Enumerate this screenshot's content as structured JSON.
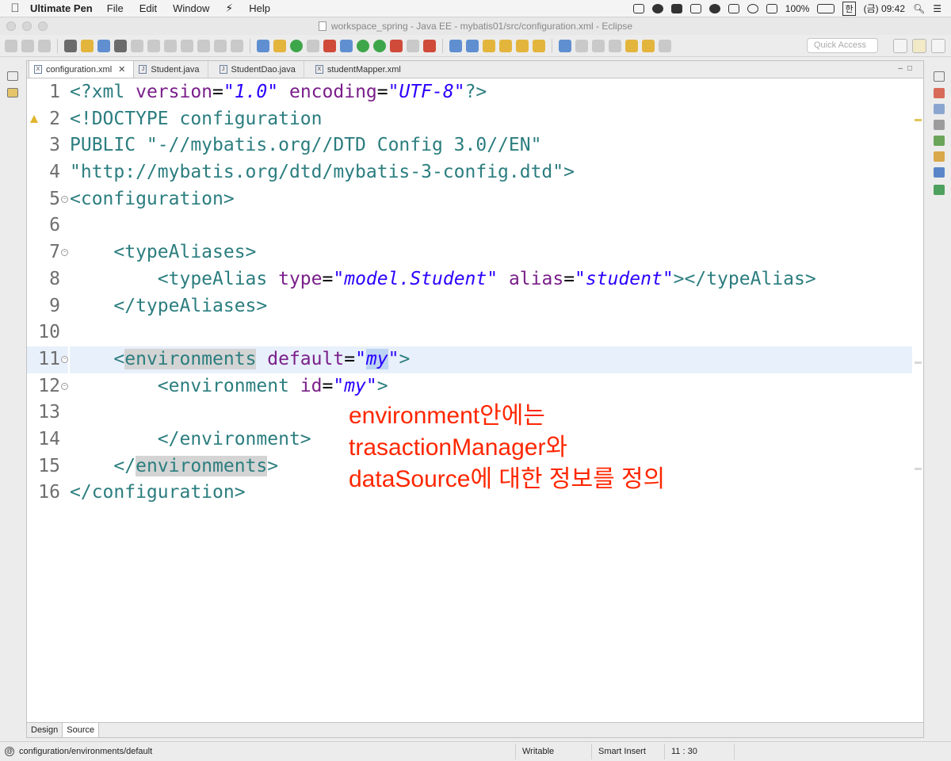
{
  "menubar": {
    "app_name": "Ultimate Pen",
    "items": [
      "File",
      "Edit",
      "Window",
      "Help"
    ],
    "battery": "100%",
    "input_method": "한",
    "clock": "(금) 09:42"
  },
  "window": {
    "title": "workspace_spring - Java EE - mybatis01/src/configuration.xml - Eclipse"
  },
  "toolbar": {
    "quick_access_placeholder": "Quick Access"
  },
  "editor": {
    "tabs": [
      {
        "label": "configuration.xml",
        "icon": "X",
        "active": true
      },
      {
        "label": "Student.java",
        "icon": "J",
        "active": false
      },
      {
        "label": "StudentDao.java",
        "icon": "J",
        "active": false
      },
      {
        "label": "studentMapper.xml",
        "icon": "X",
        "active": false
      }
    ],
    "line_numbers": [
      "1",
      "2",
      "3",
      "4",
      "5",
      "6",
      "7",
      "8",
      "9",
      "10",
      "11",
      "12",
      "13",
      "14",
      "15",
      "16"
    ],
    "code": {
      "l1_open": "<?xml ",
      "l1_attr1": "version",
      "l1_eq1": "=",
      "l1_val1": "\"1.0\"",
      "l1_attr2": " encoding",
      "l1_eq2": "=",
      "l1_val2": "\"UTF-8\"",
      "l1_close": "?>",
      "l2": "<!DOCTYPE configuration",
      "l3": "PUBLIC \"-//mybatis.org//DTD Config 3.0//EN\"",
      "l4": "\"http://mybatis.org/dtd/mybatis-3-config.dtd\">",
      "l5": "<configuration>",
      "l7": "<typeAliases>",
      "l8_open": "<typeAlias",
      "l8_attr1": " type",
      "l8_eq1": "=",
      "l8_val1": "\"model.Student\"",
      "l8_attr2": " alias",
      "l8_eq2": "=",
      "l8_val2": "\"student\"",
      "l8_close": "></typeAlias>",
      "l9": "</typeAliases>",
      "l11_lt": "<",
      "l11_tag": "environments",
      "l11_attr": " default",
      "l11_eq": "=",
      "l11_q1": "\"",
      "l11_val": "my",
      "l11_q2": "\"",
      "l11_close": ">",
      "l12_open": "<environment",
      "l12_attr": " id",
      "l12_eq": "=",
      "l12_val": "\"my\"",
      "l12_close": ">",
      "l14": "</environment>",
      "l15_lt": "</",
      "l15_tag": "environments",
      "l15_close": ">",
      "l16": "</configuration>"
    },
    "annotation": {
      "line1": "environment안에는",
      "line2": "trasactionManager와",
      "line3": "dataSource에 대한 정보를 정의"
    },
    "bottom_tabs": [
      "Design",
      "Source"
    ]
  },
  "status": {
    "path": "configuration/environments/default",
    "mode": "Writable",
    "insert": "Smart Insert",
    "position": "11 : 30"
  },
  "colors": {
    "tag": "#2b7d7f",
    "attribute": "#7a1f8a",
    "string": "#2a00ff",
    "annotation": "#ff2600",
    "current_line": "#e8f0fb"
  }
}
